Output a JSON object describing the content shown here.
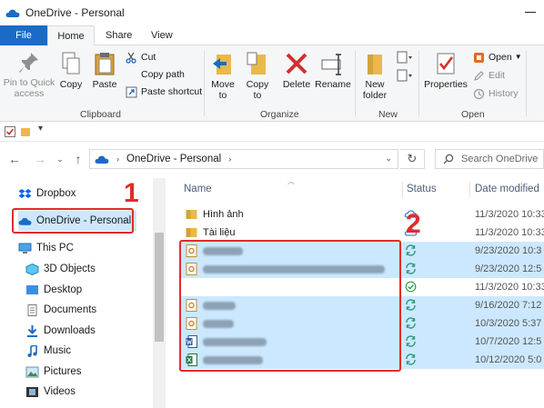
{
  "window": {
    "title": "OneDrive - Personal"
  },
  "tabs": [
    "File",
    "Home",
    "Share",
    "View"
  ],
  "ribbon": {
    "clipboard": {
      "pin_label": "Pin to Quick access",
      "copy_label": "Copy",
      "paste_label": "Paste",
      "cut_label": "Cut",
      "copy_path_label": "Copy path",
      "paste_shortcut_label": "Paste shortcut",
      "group_label": "Clipboard"
    },
    "organize": {
      "move_to_label": "Move to",
      "copy_to_label": "Copy to",
      "delete_label": "Delete",
      "rename_label": "Rename",
      "group_label": "Organize"
    },
    "new": {
      "new_folder_label": "New folder",
      "group_label": "New"
    },
    "open": {
      "properties_label": "Properties",
      "open_label": "Open",
      "edit_label": "Edit",
      "history_label": "History",
      "group_label": "Open"
    }
  },
  "address": {
    "path": "OneDrive - Personal",
    "search_placeholder": "Search OneDrive"
  },
  "nav": {
    "items": [
      {
        "label": "Dropbox"
      },
      {
        "label": "OneDrive - Personal"
      },
      {
        "label": "This PC"
      },
      {
        "label": "3D Objects"
      },
      {
        "label": "Desktop"
      },
      {
        "label": "Documents"
      },
      {
        "label": "Downloads"
      },
      {
        "label": "Music"
      },
      {
        "label": "Pictures"
      },
      {
        "label": "Videos"
      }
    ]
  },
  "columns": {
    "name": "Name",
    "status": "Status",
    "date": "Date modified"
  },
  "files": [
    {
      "name": "Hình ảnh",
      "date": "11/3/2020 10:33",
      "status": "cloud"
    },
    {
      "name": "Tài liệu",
      "date": "11/3/2020 10:33",
      "status": "cloud"
    },
    {
      "name": "",
      "date": "9/23/2020 10:3",
      "status": "sync"
    },
    {
      "name": "",
      "date": "9/23/2020 12:5",
      "status": "sync"
    },
    {
      "name": "",
      "date": "11/3/2020 10:33",
      "status": "ok"
    },
    {
      "name": "",
      "date": "9/16/2020 7:12",
      "status": "sync"
    },
    {
      "name": "",
      "date": "10/3/2020 5:37",
      "status": "sync"
    },
    {
      "name": "",
      "date": "10/7/2020 12:5",
      "status": "sync"
    },
    {
      "name": "",
      "date": "10/12/2020 5:0",
      "status": "sync"
    }
  ],
  "annotations": {
    "label_1": "1",
    "label_2": "2"
  },
  "colors": {
    "accent": "#1a6bc6",
    "selection": "#cce8ff",
    "annotation": "#e22b2b"
  }
}
